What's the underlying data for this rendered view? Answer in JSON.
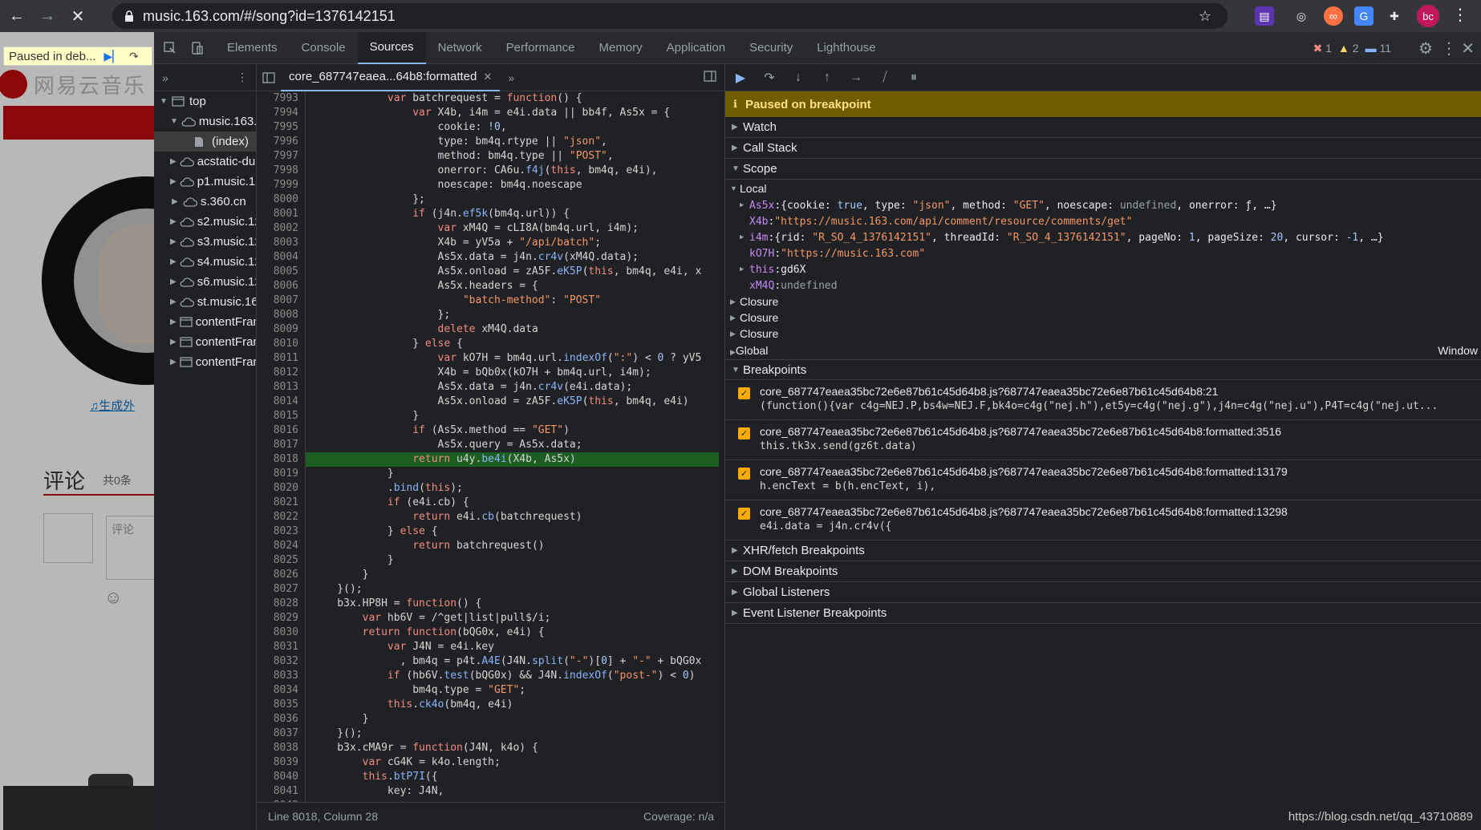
{
  "browser": {
    "url": "music.163.com/#/song?id=1376142151",
    "avatar": "bc"
  },
  "page": {
    "paused_chip": "Paused in deb...",
    "site_name": "网易云音乐",
    "gen_link": "生成外",
    "comment_title": "评论",
    "comment_count": "共0条",
    "comment_placeholder": "评论"
  },
  "devtools": {
    "tabs": [
      "Elements",
      "Console",
      "Sources",
      "Network",
      "Performance",
      "Memory",
      "Application",
      "Security",
      "Lighthouse"
    ],
    "active_tab": "Sources",
    "errors": "1",
    "warnings": "2",
    "messages": "11"
  },
  "tree": {
    "items": [
      {
        "label": "top",
        "depth": 0,
        "icon": "frame-icon",
        "expanded": true
      },
      {
        "label": "music.163.com",
        "depth": 1,
        "icon": "cloud-icon",
        "expanded": true
      },
      {
        "label": "(index)",
        "depth": 2,
        "icon": "file-icon",
        "selected": true
      },
      {
        "label": "acstatic-dun.126.net",
        "depth": 1,
        "icon": "cloud-icon"
      },
      {
        "label": "p1.music.126.net",
        "depth": 1,
        "icon": "cloud-icon"
      },
      {
        "label": "s.360.cn",
        "depth": 1,
        "icon": "cloud-icon"
      },
      {
        "label": "s2.music.126.net",
        "depth": 1,
        "icon": "cloud-icon"
      },
      {
        "label": "s3.music.126.net",
        "depth": 1,
        "icon": "cloud-icon"
      },
      {
        "label": "s4.music.126.net",
        "depth": 1,
        "icon": "cloud-icon"
      },
      {
        "label": "s6.music.126.net",
        "depth": 1,
        "icon": "cloud-icon"
      },
      {
        "label": "st.music.163.com",
        "depth": 1,
        "icon": "cloud-icon"
      },
      {
        "label": "contentFrame",
        "depth": 1,
        "icon": "frame-icon"
      },
      {
        "label": "contentFrame",
        "depth": 1,
        "icon": "frame-icon"
      },
      {
        "label": "contentFrame",
        "depth": 1,
        "icon": "frame-icon"
      }
    ]
  },
  "editor": {
    "file_tab": "core_687747eaea...64b8:formatted",
    "status_left": "Line 8018, Column 28",
    "status_right": "Coverage: n/a",
    "active_line": 8018,
    "lines": [
      {
        "n": "7993",
        "code": "            var batchrequest = function() {"
      },
      {
        "n": "7994",
        "code": "                var X4b, i4m = e4i.data || bb4f, As5x = {"
      },
      {
        "n": "7995",
        "code": "                    cookie: !0,"
      },
      {
        "n": "7996",
        "code": "                    type: bm4q.rtype || \"json\","
      },
      {
        "n": "7997",
        "code": "                    method: bm4q.type || \"POST\","
      },
      {
        "n": "7998",
        "code": "                    onerror: CA6u.f4j(this, bm4q, e4i),"
      },
      {
        "n": "7999",
        "code": "                    noescape: bm4q.noescape"
      },
      {
        "n": "8000",
        "code": "                };"
      },
      {
        "n": "8001",
        "code": "                if (j4n.ef5k(bm4q.url)) {"
      },
      {
        "n": "8002",
        "code": "                    var xM4Q = cLI8A(bm4q.url, i4m);"
      },
      {
        "n": "8003",
        "code": "                    X4b = yV5a + \"/api/batch\";"
      },
      {
        "n": "8004",
        "code": "                    As5x.data = j4n.cr4v(xM4Q.data);"
      },
      {
        "n": "8005",
        "code": "                    As5x.onload = zA5F.eK5P(this, bm4q, e4i, x"
      },
      {
        "n": "8006",
        "code": "                    As5x.headers = {"
      },
      {
        "n": "8007",
        "code": "                        \"batch-method\": \"POST\""
      },
      {
        "n": "8008",
        "code": "                    };"
      },
      {
        "n": "8009",
        "code": "                    delete xM4Q.data"
      },
      {
        "n": "8010",
        "code": "                } else {"
      },
      {
        "n": "8011",
        "code": "                    var kO7H = bm4q.url.indexOf(\":\") < 0 ? yV5"
      },
      {
        "n": "8012",
        "code": "                    X4b = bQb0x(kO7H + bm4q.url, i4m);"
      },
      {
        "n": "8013",
        "code": "                    As5x.data = j4n.cr4v(e4i.data);"
      },
      {
        "n": "8014",
        "code": "                    As5x.onload = zA5F.eK5P(this, bm4q, e4i)"
      },
      {
        "n": "8015",
        "code": "                }"
      },
      {
        "n": "8016",
        "code": "                if (As5x.method == \"GET\")"
      },
      {
        "n": "8017",
        "code": "                    As5x.query = As5x.data;"
      },
      {
        "n": "8018",
        "code": "                return u4y.be4i(X4b, As5x)"
      },
      {
        "n": "8019",
        "code": "            }"
      },
      {
        "n": "8020",
        "code": "            .bind(this);"
      },
      {
        "n": "8021",
        "code": "            if (e4i.cb) {"
      },
      {
        "n": "8022",
        "code": "                return e4i.cb(batchrequest)"
      },
      {
        "n": "8023",
        "code": "            } else {"
      },
      {
        "n": "8024",
        "code": "                return batchrequest()"
      },
      {
        "n": "8025",
        "code": "            }"
      },
      {
        "n": "8026",
        "code": "        }"
      },
      {
        "n": "8027",
        "code": "    }();"
      },
      {
        "n": "8028",
        "code": "    b3x.HP8H = function() {"
      },
      {
        "n": "8029",
        "code": "        var hb6V = /^get|list|pull$/i;"
      },
      {
        "n": "8030",
        "code": "        return function(bQG0x, e4i) {"
      },
      {
        "n": "8031",
        "code": "            var J4N = e4i.key"
      },
      {
        "n": "8032",
        "code": "              , bm4q = p4t.A4E(J4N.split(\"-\")[0] + \"-\" + bQG0x"
      },
      {
        "n": "8033",
        "code": "            if (hb6V.test(bQG0x) && J4N.indexOf(\"post-\") < 0)"
      },
      {
        "n": "8034",
        "code": "                bm4q.type = \"GET\";"
      },
      {
        "n": "8035",
        "code": "            this.ck4o(bm4q, e4i)"
      },
      {
        "n": "8036",
        "code": "        }"
      },
      {
        "n": "8037",
        "code": "    }();"
      },
      {
        "n": "8038",
        "code": "    b3x.cMA9r = function(J4N, k4o) {"
      },
      {
        "n": "8039",
        "code": "        var cG4K = k4o.length;"
      },
      {
        "n": "8040",
        "code": "        this.btP7I({"
      },
      {
        "n": "8041",
        "code": "            key: J4N,"
      },
      {
        "n": "8042",
        "code": ""
      }
    ]
  },
  "debugger": {
    "paused_banner": "Paused on breakpoint",
    "sections": {
      "watch": "Watch",
      "call_stack": "Call Stack",
      "scope": "Scope",
      "local": "Local",
      "breakpoints": "Breakpoints",
      "xhr": "XHR/fetch Breakpoints",
      "dom": "DOM Breakpoints",
      "global_listeners": "Global Listeners",
      "event_listeners": "Event Listener Breakpoints"
    },
    "scope_vars": [
      {
        "key": "As5x",
        "expandable": true,
        "value": "{cookie: true, type: \"json\", method: \"GET\", noescape: undefined, onerror: ƒ, …}"
      },
      {
        "key": "X4b",
        "expandable": false,
        "value": "\"https://music.163.com/api/comment/resource/comments/get\""
      },
      {
        "key": "i4m",
        "expandable": true,
        "value": "{rid: \"R_SO_4_1376142151\", threadId: \"R_SO_4_1376142151\", pageNo: 1, pageSize: 20, cursor: -1, …}"
      },
      {
        "key": "kO7H",
        "expandable": false,
        "value": "\"https://music.163.com\""
      },
      {
        "key": "this",
        "expandable": true,
        "value": "gd6X"
      },
      {
        "key": "xM4Q",
        "expandable": false,
        "value": "undefined"
      }
    ],
    "closures": [
      "Closure",
      "Closure",
      "Closure"
    ],
    "global_label": "Global",
    "global_value": "Window",
    "breakpoints": [
      {
        "file": "core_687747eaea35bc72e6e87b61c45d64b8.js?687747eaea35bc72e6e87b61c45d64b8:21",
        "code": "(function(){var c4g=NEJ.P,bs4w=NEJ.F,bk4o=c4g(\"nej.h\"),et5y=c4g(\"nej.g\"),j4n=c4g(\"nej.u\"),P4T=c4g(\"nej.ut..."
      },
      {
        "file": "core_687747eaea35bc72e6e87b61c45d64b8.js?687747eaea35bc72e6e87b61c45d64b8:formatted:3516",
        "code": "this.tk3x.send(gz6t.data)"
      },
      {
        "file": "core_687747eaea35bc72e6e87b61c45d64b8.js?687747eaea35bc72e6e87b61c45d64b8:formatted:13179",
        "code": "h.encText = b(h.encText, i),"
      },
      {
        "file": "core_687747eaea35bc72e6e87b61c45d64b8.js?687747eaea35bc72e6e87b61c45d64b8:formatted:13298",
        "code": "e4i.data = j4n.cr4v({"
      }
    ]
  },
  "watermark": "https://blog.csdn.net/qq_43710889"
}
